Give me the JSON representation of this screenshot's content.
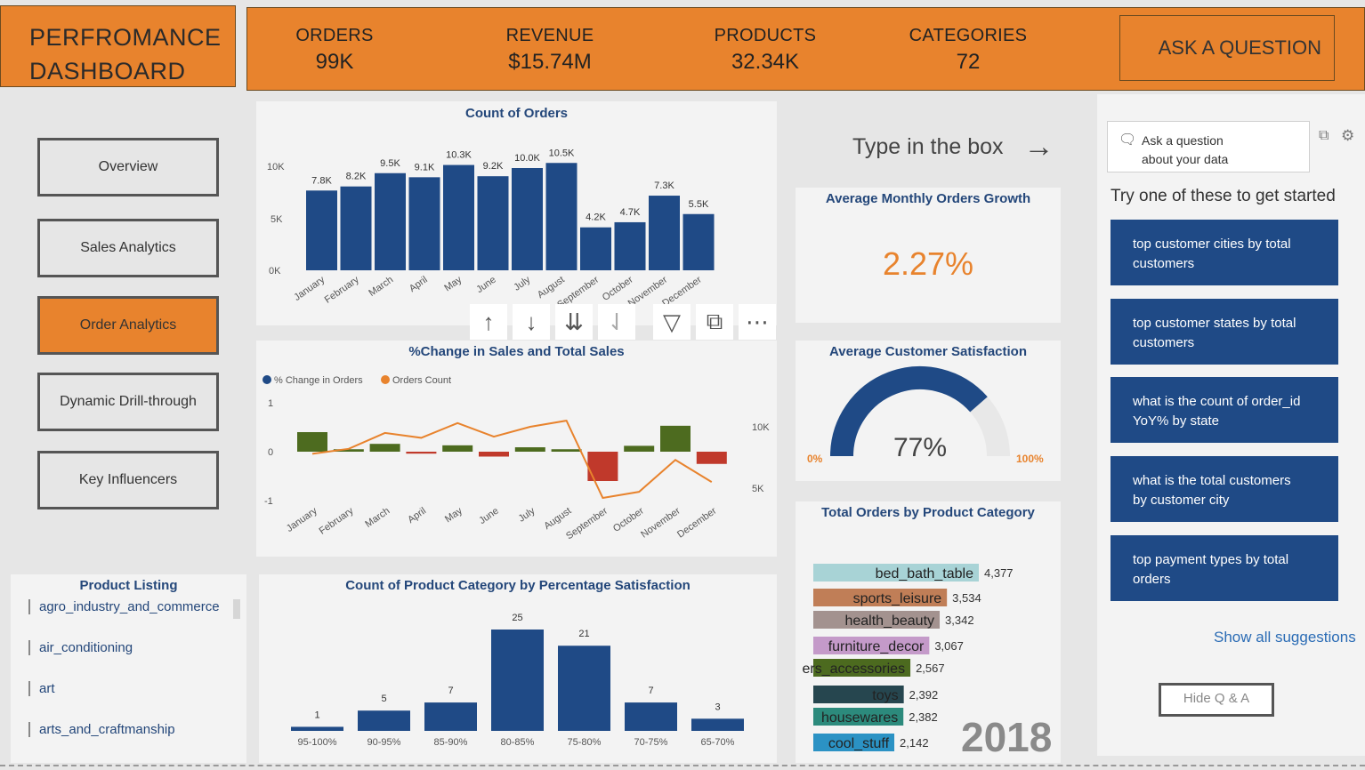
{
  "header": {
    "title_line1": "PERFROMANCE",
    "title_line2": "DASHBOARD",
    "kpis": [
      {
        "label": "ORDERS",
        "value": "99K"
      },
      {
        "label": "REVENUE",
        "value": "$15.74M"
      },
      {
        "label": "PRODUCTS",
        "value": "32.34K"
      },
      {
        "label": "CATEGORIES",
        "value": "72"
      }
    ],
    "ask_button": "ASK A QUESTION"
  },
  "nav": {
    "items": [
      "Overview",
      "Sales Analytics",
      "Order Analytics",
      "Dynamic Drill-through",
      "Key Influencers"
    ],
    "active": "Order Analytics"
  },
  "count_of_orders": {
    "title": "Count of Orders",
    "y_ticks": [
      "10K",
      "5K",
      "0K"
    ]
  },
  "pct_change": {
    "title": "%Change in Sales and Total Sales",
    "legend": [
      "% Change in Orders",
      "Orders Count"
    ],
    "y_left_ticks": [
      "1",
      "0",
      "-1"
    ],
    "y_right_ticks": [
      "10K",
      "5K"
    ]
  },
  "satisfaction_chart": {
    "title": "Count of Product Category by Percentage Satisfaction"
  },
  "product_listing": {
    "title": "Product Listing",
    "items": [
      "agro_industry_and_commerce",
      "air_conditioning",
      "art",
      "arts_and_craftmanship"
    ]
  },
  "type_box": "Type in the box",
  "avg_growth": {
    "title": "Average Monthly Orders Growth",
    "value": "2.27%"
  },
  "avg_satisfaction": {
    "title": "Average Customer Satisfaction",
    "value": "77%",
    "min": "0%",
    "max": "100%"
  },
  "orders_by_category": {
    "title": "Total Orders by Product Category",
    "year": "2018"
  },
  "qa": {
    "ask_placeholder_line1": "Ask a question",
    "ask_placeholder_line2": "about your data",
    "intro": "Try one of these to get started",
    "suggestions": [
      [
        "top customer cities by total",
        "customers"
      ],
      [
        "top customer states by total",
        "customers"
      ],
      [
        "what is the count of order_id",
        "YoY% by state"
      ],
      [
        "what is the total customers",
        "by customer city"
      ],
      [
        "top payment types by total",
        "orders"
      ]
    ],
    "show_all": "Show all suggestions",
    "hide": "Hide Q & A"
  },
  "colors": {
    "orange": "#e8832d",
    "navy": "#1f4a86",
    "green": "#4d6b1f",
    "red": "#c0392b"
  },
  "chart_data": [
    {
      "type": "bar",
      "title": "Count of Orders",
      "categories": [
        "January",
        "February",
        "March",
        "April",
        "May",
        "June",
        "July",
        "August",
        "September",
        "October",
        "November",
        "December"
      ],
      "values": [
        7800,
        8200,
        9500,
        9100,
        10300,
        9200,
        10000,
        10500,
        4200,
        4700,
        7300,
        5500
      ],
      "labels": [
        "7.8K",
        "8.2K",
        "9.5K",
        "9.1K",
        "10.3K",
        "9.2K",
        "10.0K",
        "10.5K",
        "4.2K",
        "4.7K",
        "7.3K",
        "5.5K"
      ],
      "ylim": [
        0,
        12000
      ]
    },
    {
      "type": "bar",
      "title": "%Change in Sales and Total Sales",
      "categories": [
        "January",
        "February",
        "March",
        "April",
        "May",
        "June",
        "July",
        "August",
        "September",
        "October",
        "November",
        "December"
      ],
      "series": [
        {
          "name": "% Change in Orders",
          "values": [
            0.4,
            0.05,
            0.16,
            -0.04,
            0.13,
            -0.1,
            0.09,
            0.05,
            -0.6,
            0.12,
            0.53,
            -0.25
          ]
        },
        {
          "name": "Orders Count",
          "values": [
            7800,
            8200,
            9500,
            9100,
            10300,
            9200,
            10000,
            10500,
            4200,
            4700,
            7300,
            5500
          ]
        }
      ]
    },
    {
      "type": "bar",
      "title": "Count of Product Category by Percentage Satisfaction",
      "categories": [
        "95-100%",
        "90-95%",
        "85-90%",
        "80-85%",
        "75-80%",
        "70-75%",
        "65-70%"
      ],
      "values": [
        1,
        5,
        7,
        25,
        21,
        7,
        3
      ],
      "ylim": [
        0,
        28
      ]
    },
    {
      "type": "bar",
      "title": "Total Orders by Product Category",
      "categories": [
        "bed_bath_table",
        "sports_leisure",
        "health_beauty",
        "furniture_decor",
        "ers_accessories",
        "toys",
        "housewares",
        "cool_stuff"
      ],
      "values": [
        4377,
        3534,
        3342,
        3067,
        2567,
        2392,
        2382,
        2142
      ],
      "labels": [
        "4,377",
        "3,534",
        "3,342",
        "3,067",
        "2,567",
        "2,392",
        "2,382",
        "2,142"
      ],
      "colors": [
        "#a8d3d6",
        "#c07e57",
        "#a3928f",
        "#c49ac9",
        "#4c6a1f",
        "#26464f",
        "#2c8a7c",
        "#2b92c4"
      ]
    }
  ]
}
